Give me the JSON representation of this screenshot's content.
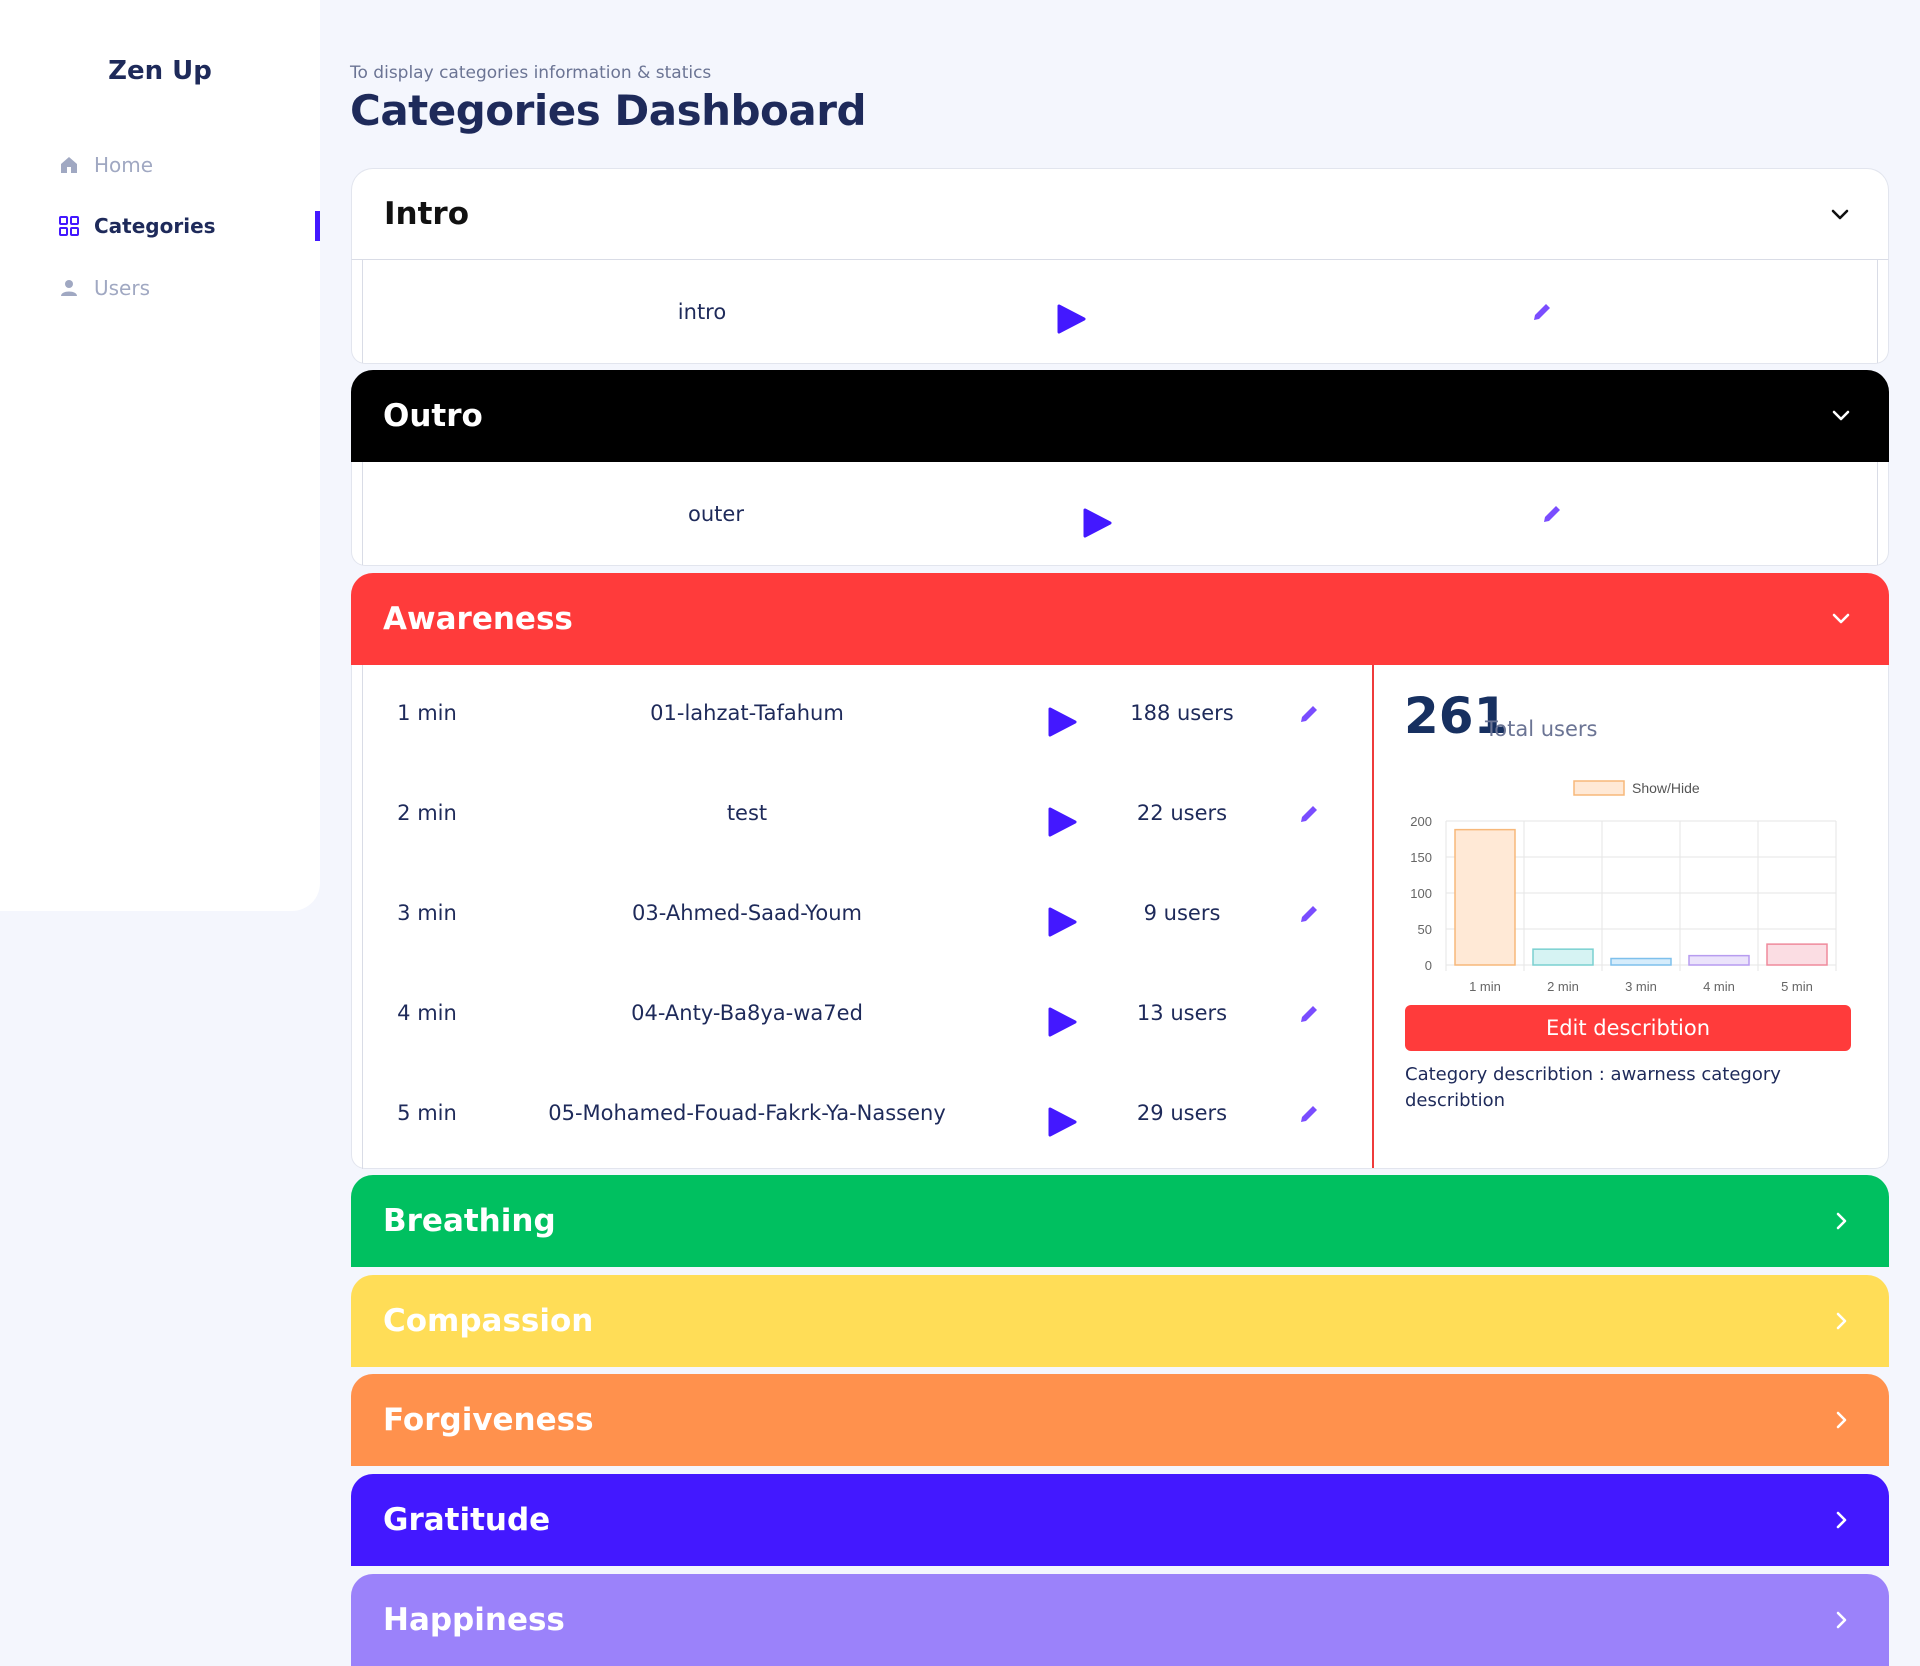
{
  "brand": "Zen Up",
  "nav": {
    "home": "Home",
    "categories": "Categories",
    "users": "Users"
  },
  "header": {
    "subtitle": "To display categories information & statics",
    "title": "Categories Dashboard"
  },
  "panels": {
    "intro": {
      "title": "Intro",
      "color": "#ffffff",
      "track": "intro"
    },
    "outro": {
      "title": "Outro",
      "color": "#000000",
      "track": "outer"
    },
    "awareness": {
      "title": "Awareness",
      "color": "#ff3b3b",
      "rows": [
        {
          "duration": "1 min",
          "name": "01-lahzat-Tafahum",
          "users": "188 users"
        },
        {
          "duration": "2 min",
          "name": "test",
          "users": "22 users"
        },
        {
          "duration": "3 min",
          "name": "03-Ahmed-Saad-Youm",
          "users": "9 users"
        },
        {
          "duration": "4 min",
          "name": "04-Anty-Ba8ya-wa7ed",
          "users": "13 users"
        },
        {
          "duration": "5 min",
          "name": "05-Mohamed-Fouad-Fakrk-Ya-Nasseny",
          "users": "29 users"
        }
      ],
      "total_users": "261",
      "total_label": "Total users",
      "edit_button": "Edit describtion",
      "description": "Category describtion : awarness category describtion"
    },
    "breathing": {
      "title": "Breathing",
      "color": "#00c060"
    },
    "compassion": {
      "title": "Compassion",
      "color": "#ffdd57"
    },
    "forgiveness": {
      "title": "Forgiveness",
      "color": "#ff914d"
    },
    "gratitude": {
      "title": "Gratitude",
      "color": "#4318ff"
    },
    "happiness": {
      "title": "Happiness",
      "color": "#9b82fa"
    }
  },
  "chart_data": {
    "type": "bar",
    "categories": [
      "1 min",
      "2 min",
      "3 min",
      "4 min",
      "5 min"
    ],
    "values": [
      188,
      22,
      9,
      13,
      29
    ],
    "legend": "Show/Hide",
    "ylim": [
      0,
      200
    ],
    "yticks": [
      "0",
      "50",
      "100",
      "150",
      "200"
    ],
    "grid": true,
    "legend_position": "top",
    "bar_fills": [
      "#ffe9d6",
      "#d6f3f3",
      "#d5ecfb",
      "#ebe3fb",
      "#fbdde3"
    ],
    "bar_strokes": [
      "#f7b87a",
      "#7ad0d0",
      "#7ec0ec",
      "#b79cf0",
      "#ef8a9c"
    ]
  }
}
